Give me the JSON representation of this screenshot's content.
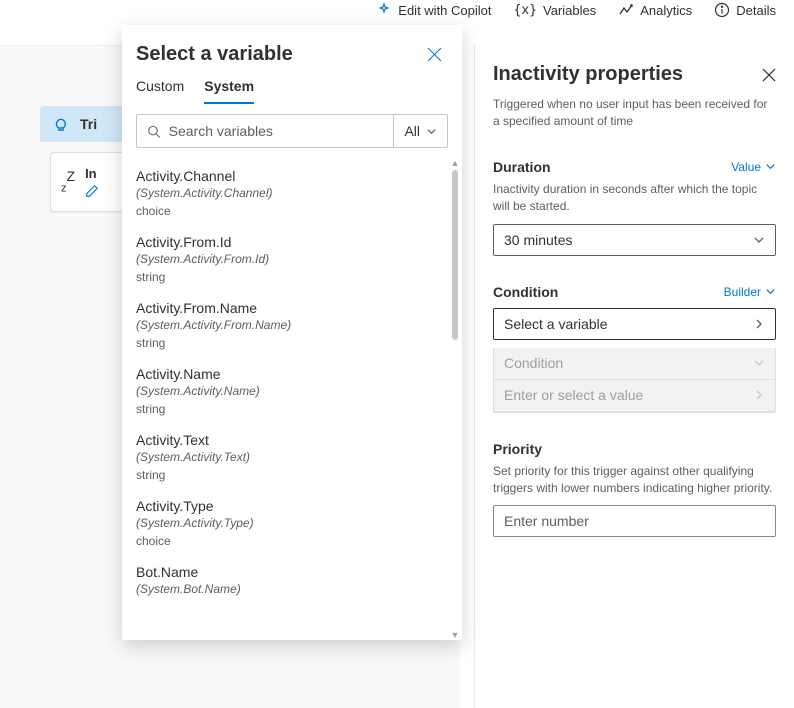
{
  "toolbar": {
    "edit": "Edit with Copilot",
    "variables": "Variables",
    "analytics": "Analytics",
    "details": "Details"
  },
  "canvas": {
    "trigger_label": "Tri",
    "node_label": "In"
  },
  "popover": {
    "title": "Select a variable",
    "tab_custom": "Custom",
    "tab_system": "System",
    "search_placeholder": "Search variables",
    "filter_label": "All",
    "items": [
      {
        "name": "Activity.Channel",
        "sys": "(System.Activity.Channel)",
        "type": "choice"
      },
      {
        "name": "Activity.From.Id",
        "sys": "(System.Activity.From.Id)",
        "type": "string"
      },
      {
        "name": "Activity.From.Name",
        "sys": "(System.Activity.From.Name)",
        "type": "string"
      },
      {
        "name": "Activity.Name",
        "sys": "(System.Activity.Name)",
        "type": "string"
      },
      {
        "name": "Activity.Text",
        "sys": "(System.Activity.Text)",
        "type": "string"
      },
      {
        "name": "Activity.Type",
        "sys": "(System.Activity.Type)",
        "type": "choice"
      },
      {
        "name": "Bot.Name",
        "sys": "(System.Bot.Name)",
        "type": ""
      }
    ]
  },
  "pane": {
    "title": "Inactivity properties",
    "subtitle": "Triggered when no user input has been received for a specified amount of time",
    "duration": {
      "label": "Duration",
      "mode": "Value",
      "desc": "Inactivity duration in seconds after which the topic will be started.",
      "value": "30 minutes"
    },
    "condition": {
      "label": "Condition",
      "mode": "Builder",
      "select_placeholder": "Select a variable",
      "op_placeholder": "Condition",
      "value_placeholder": "Enter or select a value"
    },
    "priority": {
      "label": "Priority",
      "desc": "Set priority for this trigger against other qualifying triggers with lower numbers indicating higher priority.",
      "placeholder": "Enter number"
    }
  }
}
